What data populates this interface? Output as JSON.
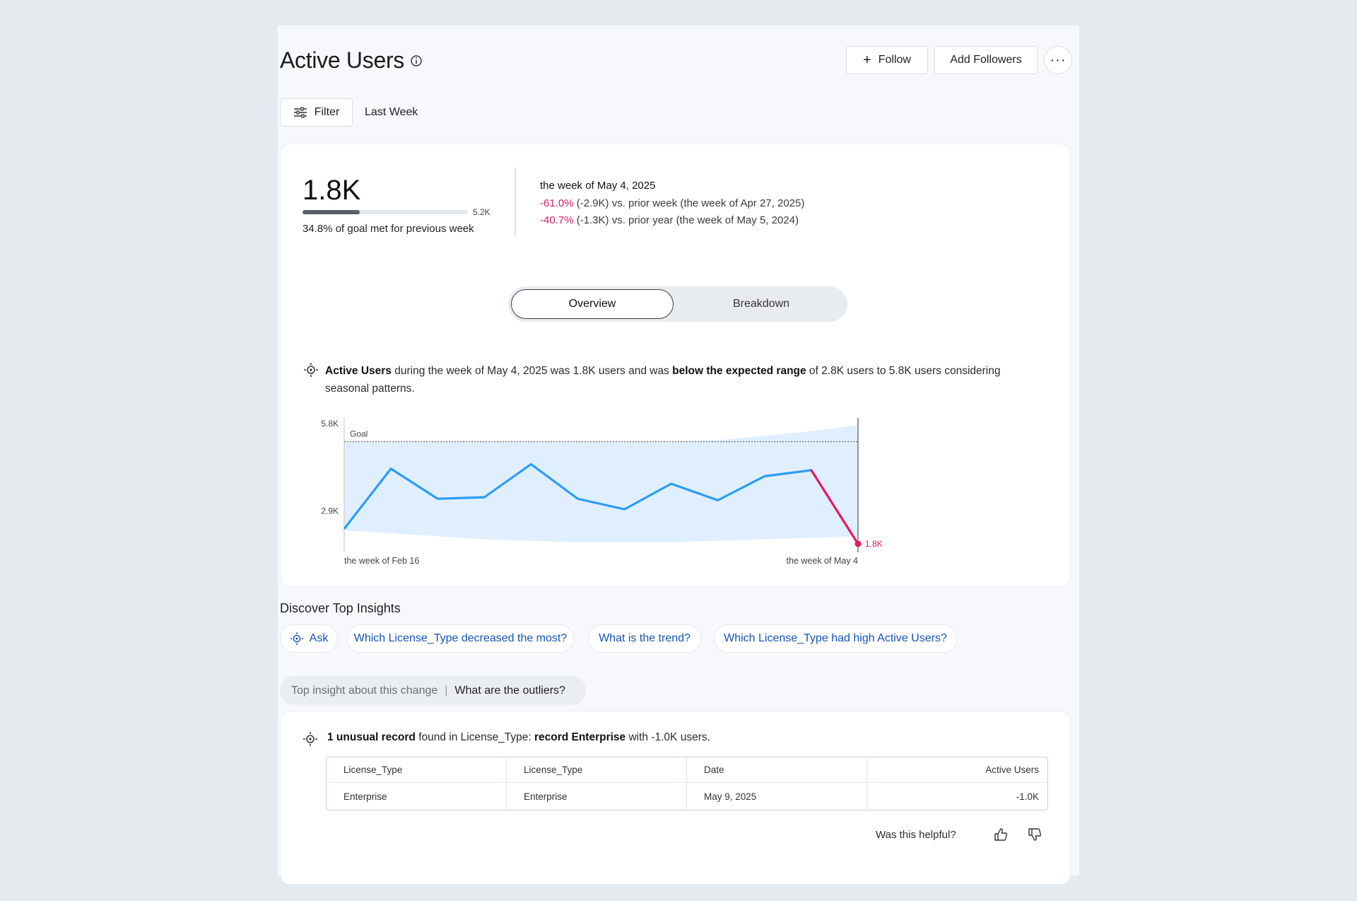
{
  "header": {
    "title": "Active Users",
    "follow_label": "Follow",
    "add_followers_label": "Add Followers",
    "more_label": "···"
  },
  "filter": {
    "label": "Filter",
    "value": "Last Week"
  },
  "kpi": {
    "value": "1.8K",
    "goal_max": "5.2K",
    "goal_progress_fraction": 0.348,
    "goal_text": "34.8% of goal met for previous week",
    "week_title": "the week of May 4, 2025",
    "cmp_week_pct": "-61.0%",
    "cmp_week_rest": " (-2.9K) vs. prior week (the week of Apr 27, 2025)",
    "cmp_year_pct": "-40.7%",
    "cmp_year_rest": " (-1.3K) vs. prior year (the week of May 5, 2024)"
  },
  "tabs": {
    "overview": "Overview",
    "breakdown": "Breakdown"
  },
  "insight": {
    "metric": "Active Users",
    "text_a": " during the week of May 4, 2025 was 1.8K users and was ",
    "highlight": "below the expected range",
    "text_b": " of 2.8K users to 5.8K users considering seasonal patterns."
  },
  "chart_data": {
    "type": "line",
    "series": [
      {
        "values": [
          2.3,
          4.3,
          3.3,
          3.35,
          4.45,
          3.3,
          2.95,
          3.8,
          3.25,
          4.05,
          4.25,
          1.8
        ]
      }
    ],
    "band_upper": [
      5.2,
      5.2,
      5.2,
      5.2,
      5.2,
      5.2,
      5.2,
      5.2,
      5.25,
      5.4,
      5.55,
      5.75
    ],
    "band_lower": [
      2.25,
      2.15,
      2.05,
      1.95,
      1.9,
      1.85,
      1.85,
      1.85,
      1.9,
      1.95,
      2.0,
      2.05
    ],
    "goal": 5.2,
    "goal_label": "Goal",
    "ylim": [
      1.8,
      5.8
    ],
    "y_ticks": [
      "5.8K",
      "2.9K"
    ],
    "y_tick_values": [
      5.8,
      2.9
    ],
    "x_start_label": "the week of Feb 16",
    "x_end_label": "the week of May 4",
    "last_value_label": "1.8K",
    "line_color": "#2a9df4",
    "drop_color": "#e8185d",
    "band_color": "#e0efff"
  },
  "discover": {
    "title": "Discover Top Insights",
    "ask": "Ask",
    "q1": "Which License_Type decreased the most?",
    "q2": "What is the trend?",
    "q3": "Which License_Type had high Active Users?"
  },
  "top_insight": {
    "label": "Top insight about this change",
    "sep": "|",
    "question": "What are the outliers?"
  },
  "outlier": {
    "count": "1 unusual record",
    "mid": " found in License_Type: ",
    "record": "record Enterprise",
    "tail": " with -1.0K users."
  },
  "table": {
    "headers": [
      "License_Type",
      "License_Type",
      "Date",
      "Active Users"
    ],
    "row": [
      "Enterprise",
      "Enterprise",
      "May 9, 2025",
      "-1.0K"
    ]
  },
  "feedback": {
    "label": "Was this helpful?"
  }
}
